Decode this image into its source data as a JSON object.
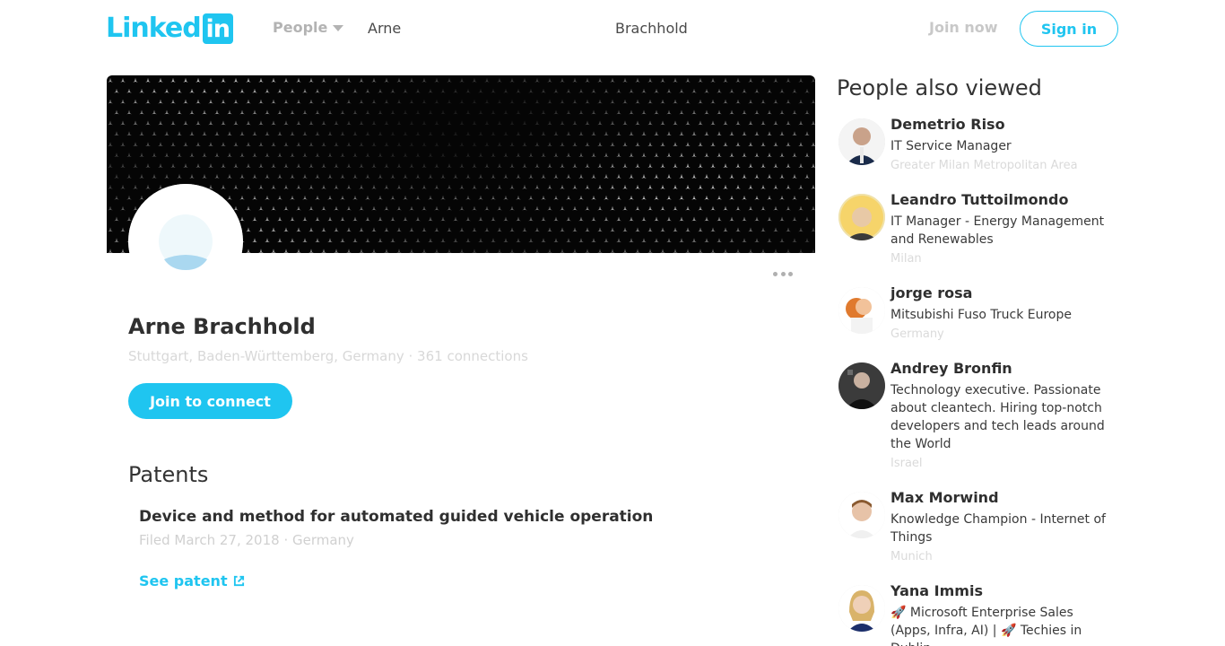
{
  "header": {
    "logo_text": "Linked",
    "logo_box_text": "in",
    "people_dropdown": "People",
    "search_first_name": "Arne",
    "search_last_name": "Brachhold",
    "join_now": "Join now",
    "sign_in": "Sign in",
    "brand_color": "#1fc5f0"
  },
  "profile": {
    "name": "Arne Brachhold",
    "location_line": "Stuttgart, Baden-Württemberg, Germany · 361 connections",
    "join_button": "Join to connect"
  },
  "patents": {
    "section_title": "Patents",
    "items": [
      {
        "title": "Device and method for automated guided vehicle operation",
        "meta": "Filed March 27, 2018 · Germany",
        "link_label": "See patent"
      }
    ]
  },
  "sidebar": {
    "title": "People also viewed",
    "people": [
      {
        "name": "Demetrio Riso",
        "headline": "IT Service Manager",
        "location": "Greater Milan Metropolitan Area"
      },
      {
        "name": "Leandro Tuttoilmondo",
        "headline": "IT Manager - Energy Management and Renewables",
        "location": "Milan"
      },
      {
        "name": "jorge rosa",
        "headline": "Mitsubishi Fuso Truck Europe",
        "location": "Germany"
      },
      {
        "name": "Andrey Bronfin",
        "headline": "Technology executive. Passionate about cleantech. Hiring top-notch developers and tech leads around the World",
        "location": "Israel"
      },
      {
        "name": "Max Morwind",
        "headline": "Knowledge Champion - Internet of Things",
        "location": "Munich"
      },
      {
        "name": "Yana Immis",
        "headline": "🚀 Microsoft Enterprise Sales (Apps, Infra, AI) | 🚀 Techies in Dublin",
        "location": ""
      }
    ]
  }
}
